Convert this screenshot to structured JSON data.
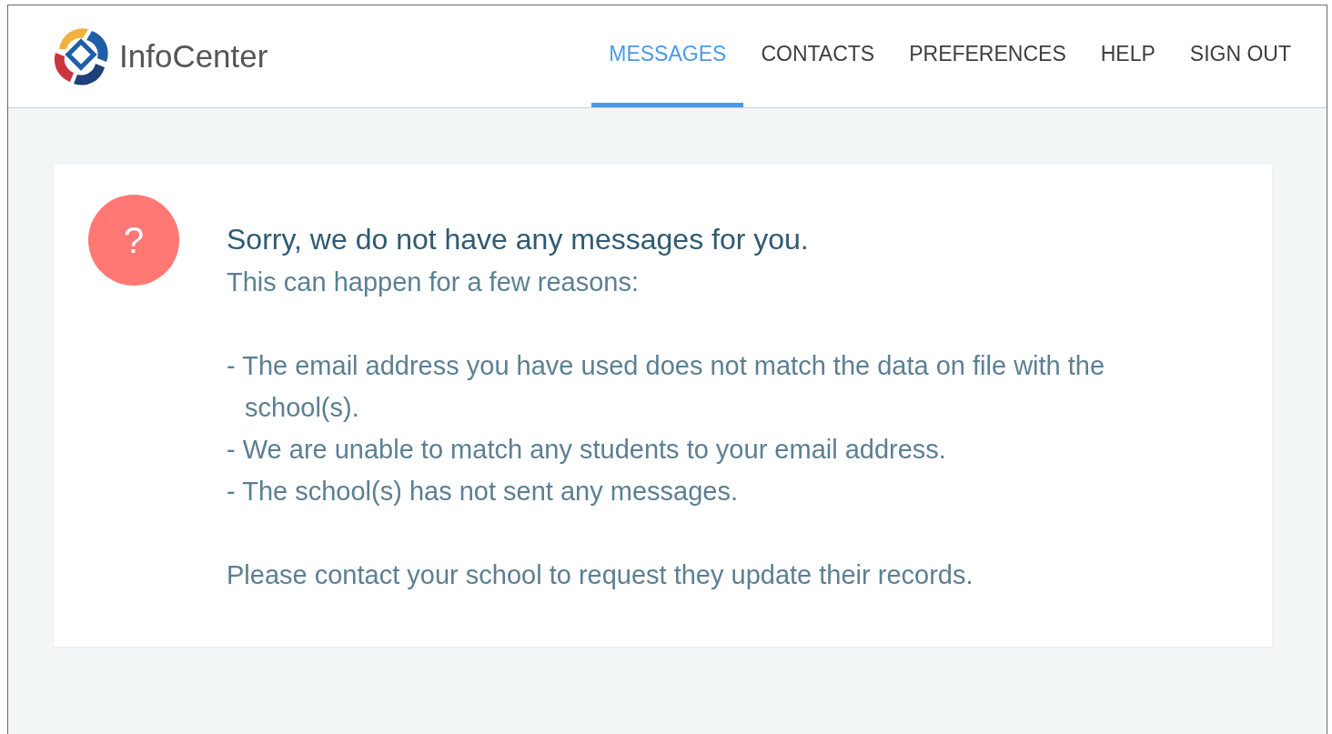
{
  "header": {
    "brand": "InfoCenter",
    "nav": [
      {
        "label": "MESSAGES",
        "selected": true
      },
      {
        "label": "CONTACTS",
        "selected": false
      },
      {
        "label": "PREFERENCES",
        "selected": false
      },
      {
        "label": "HELP",
        "selected": false
      },
      {
        "label": "SIGN OUT",
        "selected": false
      }
    ]
  },
  "notice": {
    "icon": "?",
    "title": "Sorry, we do not have any messages for you.",
    "intro": "This can happen for a few reasons:",
    "reasons": [
      "- The email address you have used does not match the data on file with the school(s).",
      "- We are unable to match any students to your email address.",
      "- The school(s) has not sent any messages."
    ],
    "closing": "Please contact your school  to request they update their records."
  }
}
